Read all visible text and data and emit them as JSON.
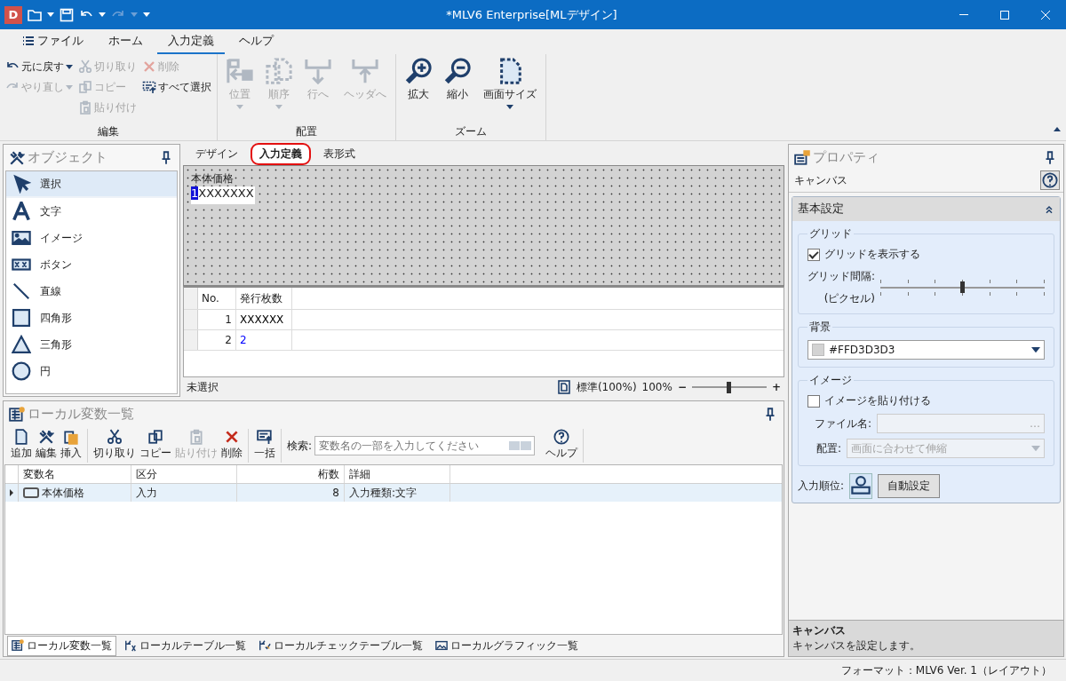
{
  "window": {
    "title": "*MLV6 Enterprise[MLデザイン]",
    "app_icon_letter": "D"
  },
  "menu_tabs": [
    {
      "label": "ファイル",
      "selected": false,
      "has_icon": true
    },
    {
      "label": "ホーム",
      "selected": false,
      "has_icon": false
    },
    {
      "label": "入力定義",
      "selected": true,
      "has_icon": false
    },
    {
      "label": "ヘルプ",
      "selected": false,
      "has_icon": false
    }
  ],
  "ribbon": [
    {
      "label": "編集",
      "kind": "small",
      "columns": [
        [
          {
            "label": "元に戻す",
            "disabled": false,
            "dropdown": true
          },
          {
            "label": "やり直し",
            "disabled": true,
            "dropdown": true
          }
        ],
        [
          {
            "label": "切り取り",
            "disabled": true,
            "dropdown": false
          },
          {
            "label": "コピー",
            "disabled": true,
            "dropdown": false
          },
          {
            "label": "貼り付け",
            "disabled": true,
            "dropdown": false
          }
        ],
        [
          {
            "label": "削除",
            "disabled": true,
            "dropdown": false
          },
          {
            "label": "すべて選択",
            "disabled": false,
            "dropdown": false
          }
        ]
      ]
    },
    {
      "label": "配置",
      "kind": "large",
      "buttons": [
        {
          "label": "位置",
          "disabled": true,
          "dropdown": true
        },
        {
          "label": "順序",
          "disabled": true,
          "dropdown": true
        },
        {
          "label": "行へ",
          "disabled": true,
          "dropdown": false
        },
        {
          "label": "ヘッダへ",
          "disabled": true,
          "dropdown": false
        }
      ]
    },
    {
      "label": "ズーム",
      "kind": "large",
      "buttons": [
        {
          "label": "拡大",
          "disabled": false,
          "dropdown": false
        },
        {
          "label": "縮小",
          "disabled": false,
          "dropdown": false
        },
        {
          "label": "画面サイズ",
          "disabled": false,
          "dropdown": true
        }
      ]
    }
  ],
  "objects": {
    "title": "オブジェクト",
    "items": [
      {
        "label": "選択",
        "kind": "pointer",
        "selected": true
      },
      {
        "label": "文字",
        "kind": "text",
        "selected": false
      },
      {
        "label": "イメージ",
        "kind": "image",
        "selected": false
      },
      {
        "label": "ボタン",
        "kind": "button",
        "selected": false
      },
      {
        "label": "直線",
        "kind": "line",
        "selected": false
      },
      {
        "label": "四角形",
        "kind": "rectangle",
        "selected": false
      },
      {
        "label": "三角形",
        "kind": "triangle",
        "selected": false
      },
      {
        "label": "円",
        "kind": "circle",
        "selected": false
      }
    ]
  },
  "designer": {
    "tabs": [
      {
        "label": "デザイン",
        "selected": false,
        "highlighted": false
      },
      {
        "label": "入力定義",
        "selected": true,
        "highlighted": true
      },
      {
        "label": "表形式",
        "selected": false,
        "highlighted": false
      }
    ],
    "canvas_field": {
      "label": "本体価格",
      "cursor_char": "1",
      "value": "XXXXXXX"
    },
    "grid": {
      "columns": [
        "No.",
        "発行枚数"
      ],
      "rows": [
        {
          "no": "1",
          "value": "XXXXXX",
          "color": "#000000"
        },
        {
          "no": "2",
          "value": "2",
          "color": "#0000ff"
        }
      ]
    },
    "status": "未選択",
    "zoom_mode": "標準(100%)",
    "zoom_reading": "100%",
    "zoom_minus": "−",
    "zoom_plus": "+",
    "zoom": {
      "level": 0.5
    }
  },
  "locals": {
    "title": "ローカル変数一覧",
    "toolbar": [
      [
        {
          "label": "追加",
          "disabled": false
        },
        {
          "label": "編集",
          "disabled": false
        },
        {
          "label": "挿入",
          "disabled": false
        }
      ],
      [
        {
          "label": "切り取り",
          "disabled": false
        },
        {
          "label": "コピー",
          "disabled": false
        },
        {
          "label": "貼り付け",
          "disabled": true
        },
        {
          "label": "削除",
          "disabled": false
        }
      ],
      [
        {
          "label": "一括",
          "disabled": false
        }
      ]
    ],
    "search_label": "検索:",
    "search_placeholder": "変数名の一部を入力してください",
    "help": "ヘルプ",
    "columns": [
      "変数名",
      "区分",
      "桁数",
      "詳細"
    ],
    "rows": [
      {
        "cells": [
          "本体価格",
          "入力",
          "8",
          "入力種類:文字"
        ],
        "selected": true
      }
    ],
    "tabs": [
      {
        "label": "ローカル変数一覧",
        "selected": true
      },
      {
        "label": "ローカルテーブル一覧",
        "selected": false
      },
      {
        "label": "ローカルチェックテーブル一覧",
        "selected": false
      },
      {
        "label": "ローカルグラフィック一覧",
        "selected": false
      }
    ]
  },
  "properties": {
    "title": "プロパティ",
    "subject": "キャンバス",
    "section": "基本設定",
    "grid_group": "グリッド",
    "show_grid": {
      "label": "グリッドを表示する",
      "checked": true
    },
    "interval_label": "グリッド間隔:",
    "interval_unit": "(ピクセル)",
    "interval": {
      "level": 0.5
    },
    "background_group": "背景",
    "background": {
      "value": "#FFD3D3D3",
      "color": "#d3d3d3"
    },
    "image_group": "イメージ",
    "paste_image": {
      "label": "イメージを貼り付ける",
      "checked": false
    },
    "file_label": "ファイル名:",
    "browse": "…",
    "layout_label": "配置:",
    "layout_value": "画面に合わせて伸縮",
    "order_label": "入力順位:",
    "auto_button": "自動設定",
    "footer_title": "キャンバス",
    "footer_text": "キャンバスを設定します。"
  },
  "status_bar": "フォーマット：MLV6 Ver. 1（レイアウト）"
}
